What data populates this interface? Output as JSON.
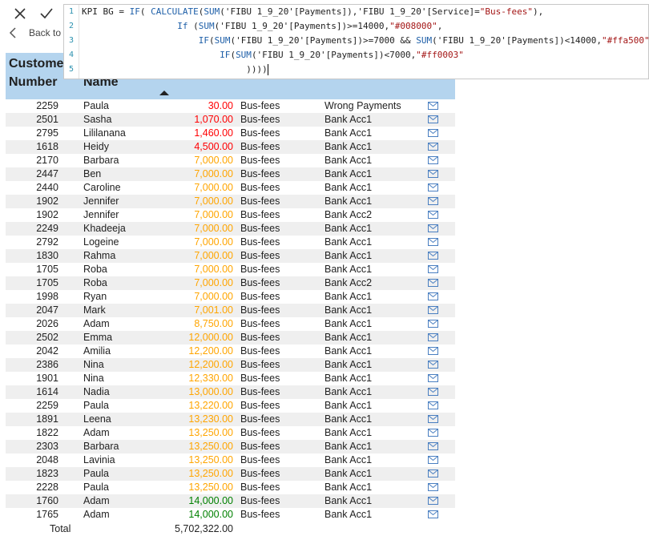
{
  "back_label": "Back to",
  "formula": {
    "line_numbers": [
      "1",
      "2",
      "3",
      "4",
      "5"
    ]
  },
  "table": {
    "headers": {
      "customer_number": "Custome Number",
      "name": "Name"
    },
    "colors": {
      "header_bg": "#b4d4ee",
      "red": "#ff0003",
      "orange": "#ffa500",
      "green": "#008000",
      "mail_icon": "#4a7fc1"
    },
    "rows": [
      {
        "num": "2259",
        "name": "Paula",
        "payment": "30.00",
        "color": "#ff0003",
        "service": "Bus-fees",
        "account": "Wrong Payments"
      },
      {
        "num": "2501",
        "name": "Sasha",
        "payment": "1,070.00",
        "color": "#ff0003",
        "service": "Bus-fees",
        "account": "Bank Acc1"
      },
      {
        "num": "2795",
        "name": "Lililanana",
        "payment": "1,460.00",
        "color": "#ff0003",
        "service": "Bus-fees",
        "account": "Bank Acc1"
      },
      {
        "num": "1618",
        "name": "Heidy",
        "payment": "4,500.00",
        "color": "#ff0003",
        "service": "Bus-fees",
        "account": "Bank Acc1"
      },
      {
        "num": "2170",
        "name": "Barbara",
        "payment": "7,000.00",
        "color": "#ffa500",
        "service": "Bus-fees",
        "account": "Bank Acc1"
      },
      {
        "num": "2447",
        "name": "Ben",
        "payment": "7,000.00",
        "color": "#ffa500",
        "service": "Bus-fees",
        "account": "Bank Acc1"
      },
      {
        "num": "2440",
        "name": "Caroline",
        "payment": "7,000.00",
        "color": "#ffa500",
        "service": "Bus-fees",
        "account": "Bank Acc1"
      },
      {
        "num": "1902",
        "name": "Jennifer",
        "payment": "7,000.00",
        "color": "#ffa500",
        "service": "Bus-fees",
        "account": "Bank Acc1"
      },
      {
        "num": "1902",
        "name": "Jennifer",
        "payment": "7,000.00",
        "color": "#ffa500",
        "service": "Bus-fees",
        "account": "Bank Acc2"
      },
      {
        "num": "2249",
        "name": "Khadeeja",
        "payment": "7,000.00",
        "color": "#ffa500",
        "service": "Bus-fees",
        "account": "Bank Acc1"
      },
      {
        "num": "2792",
        "name": "Logeine",
        "payment": "7,000.00",
        "color": "#ffa500",
        "service": "Bus-fees",
        "account": "Bank Acc1"
      },
      {
        "num": "1830",
        "name": "Rahma",
        "payment": "7,000.00",
        "color": "#ffa500",
        "service": "Bus-fees",
        "account": "Bank Acc1"
      },
      {
        "num": "1705",
        "name": "Roba",
        "payment": "7,000.00",
        "color": "#ffa500",
        "service": "Bus-fees",
        "account": "Bank Acc1"
      },
      {
        "num": "1705",
        "name": "Roba",
        "payment": "7,000.00",
        "color": "#ffa500",
        "service": "Bus-fees",
        "account": "Bank Acc2"
      },
      {
        "num": "1998",
        "name": "Ryan",
        "payment": "7,000.00",
        "color": "#ffa500",
        "service": "Bus-fees",
        "account": "Bank Acc1"
      },
      {
        "num": "2047",
        "name": "Mark",
        "payment": "7,001.00",
        "color": "#ffa500",
        "service": "Bus-fees",
        "account": "Bank Acc1"
      },
      {
        "num": "2026",
        "name": "Adam",
        "payment": "8,750.00",
        "color": "#ffa500",
        "service": "Bus-fees",
        "account": "Bank Acc1"
      },
      {
        "num": "2502",
        "name": "Emma",
        "payment": "12,000.00",
        "color": "#ffa500",
        "service": "Bus-fees",
        "account": "Bank Acc1"
      },
      {
        "num": "2042",
        "name": "Amilia",
        "payment": "12,200.00",
        "color": "#ffa500",
        "service": "Bus-fees",
        "account": "Bank Acc1"
      },
      {
        "num": "2386",
        "name": "Nina",
        "payment": "12,200.00",
        "color": "#ffa500",
        "service": "Bus-fees",
        "account": "Bank Acc1"
      },
      {
        "num": "1901",
        "name": "Nina",
        "payment": "12,330.00",
        "color": "#ffa500",
        "service": "Bus-fees",
        "account": "Bank Acc1"
      },
      {
        "num": "1614",
        "name": "Nadia",
        "payment": "13,000.00",
        "color": "#ffa500",
        "service": "Bus-fees",
        "account": "Bank Acc1"
      },
      {
        "num": "2259",
        "name": "Paula",
        "payment": "13,220.00",
        "color": "#ffa500",
        "service": "Bus-fees",
        "account": "Bank Acc1"
      },
      {
        "num": "1891",
        "name": "Leena",
        "payment": "13,230.00",
        "color": "#ffa500",
        "service": "Bus-fees",
        "account": "Bank Acc1"
      },
      {
        "num": "1822",
        "name": "Adam",
        "payment": "13,250.00",
        "color": "#ffa500",
        "service": "Bus-fees",
        "account": "Bank Acc1"
      },
      {
        "num": "2303",
        "name": "Barbara",
        "payment": "13,250.00",
        "color": "#ffa500",
        "service": "Bus-fees",
        "account": "Bank Acc1"
      },
      {
        "num": "2048",
        "name": "Lavinia",
        "payment": "13,250.00",
        "color": "#ffa500",
        "service": "Bus-fees",
        "account": "Bank Acc1"
      },
      {
        "num": "1823",
        "name": "Paula",
        "payment": "13,250.00",
        "color": "#ffa500",
        "service": "Bus-fees",
        "account": "Bank Acc1"
      },
      {
        "num": "2228",
        "name": "Paula",
        "payment": "13,250.00",
        "color": "#ffa500",
        "service": "Bus-fees",
        "account": "Bank Acc1"
      },
      {
        "num": "1760",
        "name": "Adam",
        "payment": "14,000.00",
        "color": "#008000",
        "service": "Bus-fees",
        "account": "Bank Acc1"
      },
      {
        "num": "1765",
        "name": "Adam",
        "payment": "14,000.00",
        "color": "#008000",
        "service": "Bus-fees",
        "account": "Bank Acc1"
      }
    ],
    "total_label": "Total",
    "total_value": "5,702,322.00"
  }
}
